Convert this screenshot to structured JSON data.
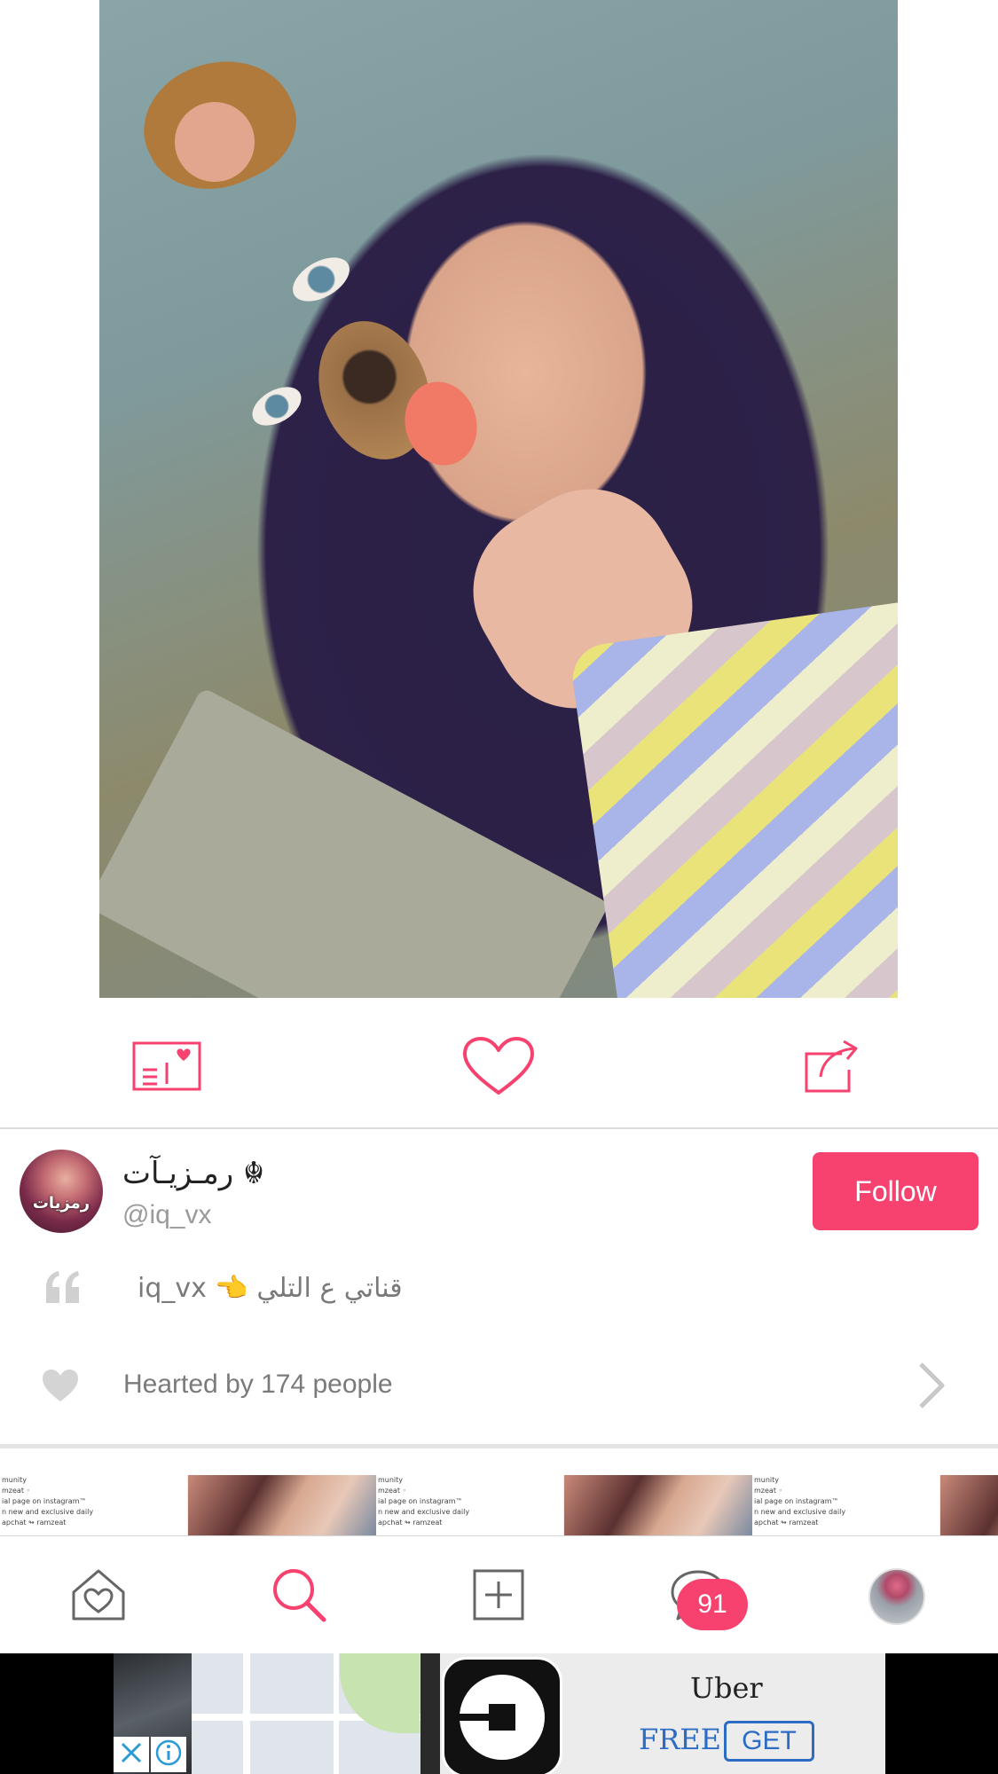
{
  "post": {
    "author_name": "رمـزيـآت ☬",
    "author_handle": "@iq_vx",
    "avatar_text": "رمزيات",
    "follow_label": "Follow",
    "caption": "iq_vx 👈 قناتي ع التلي",
    "hearted_by": "Hearted by 174 people"
  },
  "ad_strip": {
    "lines": [
      "munity",
      "mzeat ◦",
      "ial page on instagram™",
      "n new and exclusive daily",
      "apchat ↬ ramzeat"
    ]
  },
  "tab_bar": {
    "items": [
      {
        "name": "home",
        "icon": "home-heart-icon"
      },
      {
        "name": "search",
        "icon": "search-icon",
        "active": true
      },
      {
        "name": "create",
        "icon": "plus-square-icon"
      },
      {
        "name": "messages",
        "icon": "chat-bubble-icon"
      },
      {
        "name": "profile",
        "icon": "profile-avatar"
      }
    ],
    "messages_badge": "91"
  },
  "banner_ad": {
    "app_name": "Uber",
    "price": "FREE",
    "cta": "GET"
  },
  "colors": {
    "accent": "#f7426f",
    "muted_text": "#9a9a9a",
    "link_blue": "#2c6cc4"
  }
}
